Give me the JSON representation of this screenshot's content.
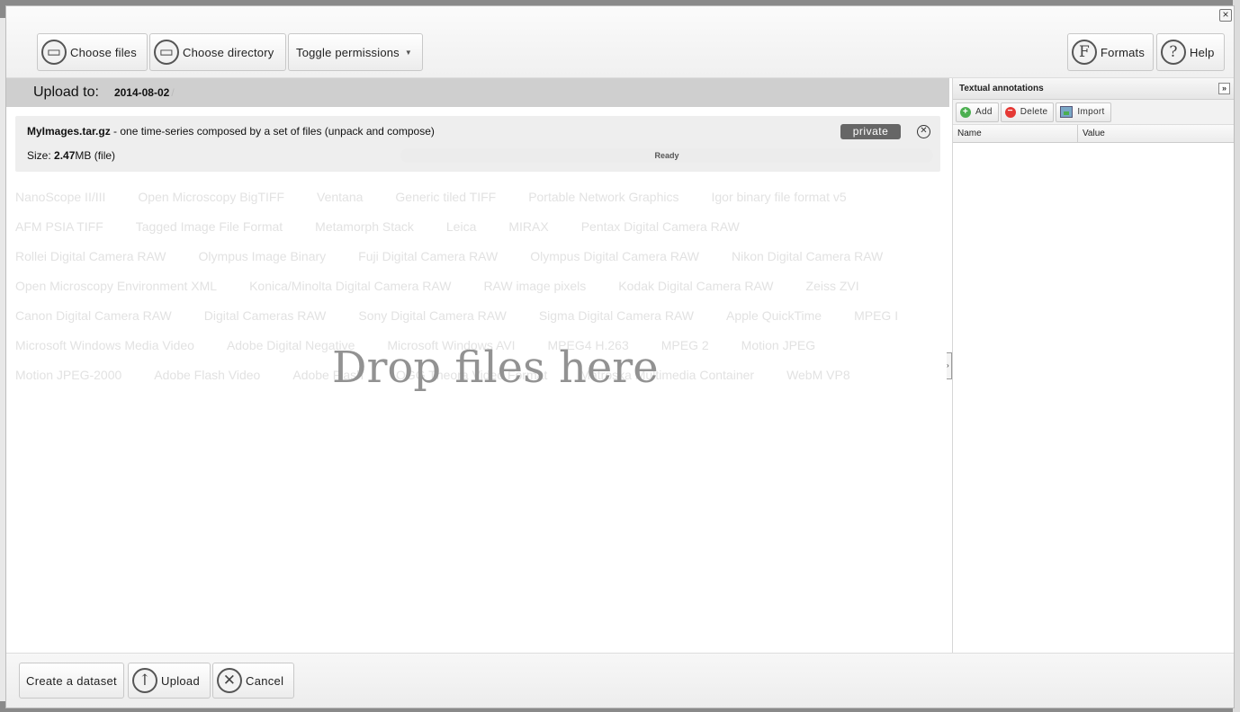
{
  "toolbar": {
    "choose_files": "Choose files",
    "choose_directory": "Choose directory",
    "toggle_permissions": "Toggle permissions",
    "formats": "Formats",
    "help": "Help"
  },
  "upload_to": {
    "label": "Upload to:",
    "path": "2014-08-02",
    "separator": "/"
  },
  "file": {
    "name": "MyImages.tar.gz",
    "description": " - one time-series composed by a set of files (unpack and compose)",
    "size_label": "Size: ",
    "size_value": "2.47",
    "size_unit": "MB (file)",
    "permission": "private",
    "status": "Ready"
  },
  "formats": [
    "NanoScope II/III",
    "Open Microscopy BigTIFF",
    "Ventana",
    "Generic tiled TIFF",
    "Portable Network Graphics",
    "Igor binary file format v5",
    "AFM PSIA TIFF",
    "Tagged Image File Format",
    "Metamorph Stack",
    "Leica",
    "MIRAX",
    "Pentax Digital Camera RAW",
    "Rollei Digital Camera RAW",
    "Olympus Image Binary",
    "Fuji Digital Camera RAW",
    "Olympus Digital Camera RAW",
    "Nikon Digital Camera RAW",
    "Open Microscopy Environment XML",
    "Konica/Minolta Digital Camera RAW",
    "RAW image pixels",
    "Kodak Digital Camera RAW",
    "Zeiss ZVI",
    "Canon Digital Camera RAW",
    "Digital Cameras RAW",
    "Sony Digital Camera RAW",
    "Sigma Digital Camera RAW",
    "Apple QuickTime",
    "MPEG I",
    "Microsoft Windows Media Video",
    "Adobe Digital Negative",
    "Microsoft Windows AVI",
    "MPEG4 H.263",
    "MPEG 2",
    "Motion JPEG",
    "Motion JPEG-2000",
    "Adobe Flash Video",
    "Adobe Flash",
    "OGG Theora Video Format",
    "Matroska Multimedia Container",
    "WebM VP8"
  ],
  "drop_text": "Drop files here",
  "annotations": {
    "title": "Textual annotations",
    "add": "Add",
    "delete": "Delete",
    "import": "Import",
    "col_name": "Name",
    "col_value": "Value"
  },
  "footer": {
    "create_dataset": "Create a dataset",
    "upload": "Upload",
    "cancel": "Cancel"
  }
}
